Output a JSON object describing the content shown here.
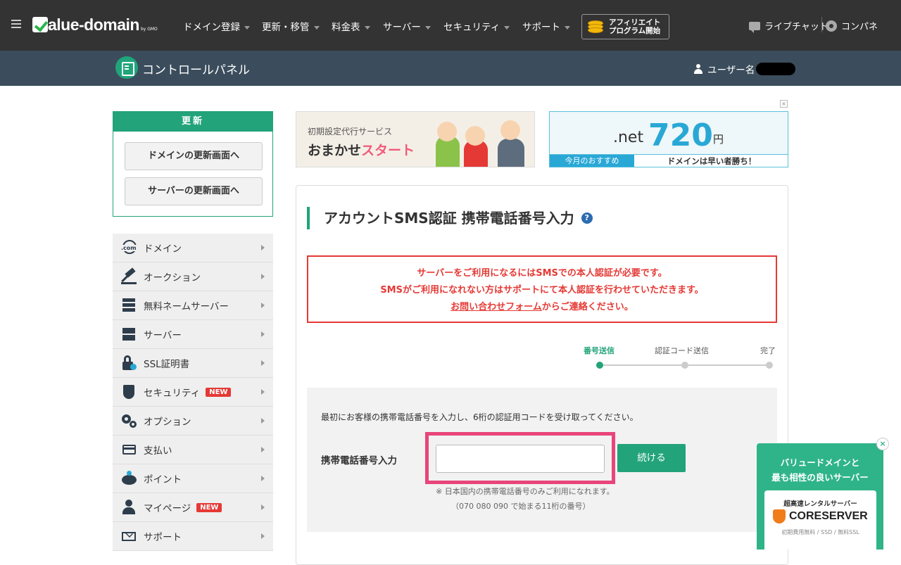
{
  "topnav": {
    "logo_text": "alue-domain",
    "logo_suffix": "by GMO",
    "items": [
      "ドメイン登録",
      "更新・移管",
      "料金表",
      "サーバー",
      "セキュリティ",
      "サポート"
    ],
    "affiliate_line1": "アフィリエイト",
    "affiliate_line2": "プログラム開始",
    "livechat": "ライブチャット",
    "cpanel": "コンパネ"
  },
  "subheader": {
    "title": "コントロールパネル",
    "user_label": "ユーザー名"
  },
  "renew": {
    "heading": "更新",
    "domain_button": "ドメインの更新画面へ",
    "server_button": "サーバーの更新画面へ"
  },
  "menu": [
    {
      "label": "ドメイン",
      "icon": "com-globe-icon",
      "badge": ""
    },
    {
      "label": "オークション",
      "icon": "gavel-icon",
      "badge": ""
    },
    {
      "label": "無料ネームサーバー",
      "icon": "server-stack-icon",
      "badge": ""
    },
    {
      "label": "サーバー",
      "icon": "server-icon",
      "badge": ""
    },
    {
      "label": "SSL証明書",
      "icon": "lock-icon",
      "badge": ""
    },
    {
      "label": "セキュリティ",
      "icon": "shield-icon",
      "badge": "NEW"
    },
    {
      "label": "オプション",
      "icon": "gears-icon",
      "badge": ""
    },
    {
      "label": "支払い",
      "icon": "card-icon",
      "badge": ""
    },
    {
      "label": "ポイント",
      "icon": "piggy-bank-icon",
      "badge": ""
    },
    {
      "label": "マイページ",
      "icon": "user-icon",
      "badge": "NEW"
    },
    {
      "label": "サポート",
      "icon": "mail-icon",
      "badge": ""
    }
  ],
  "banner1": {
    "sub": "初期設定代行サービス",
    "main_a": "おまかせ",
    "main_b": "スタート"
  },
  "banner2": {
    "tld": ".net",
    "price": "720",
    "yen": "円",
    "left": "今月のおすすめ",
    "right": "ドメインは早い者勝ち！",
    "close": "×"
  },
  "page": {
    "title": "アカウントSMS認証 携帯電話番号入力",
    "help": "?"
  },
  "alert": {
    "line1": "サーバーをご利用になるにはSMSでの本人認証が必要です。",
    "line2": "SMSがご利用になれない方はサポートにて本人認証を行わせていただきます。",
    "link": "お問い合わせフォーム",
    "line3_rest": "からご連絡ください。"
  },
  "steps": {
    "items": [
      "番号送信",
      "認証コード送信",
      "完了"
    ],
    "current": 0,
    "active_color": "#23a37a"
  },
  "form": {
    "intro": "最初にお客様の携帯電話番号を入力し、6桁の認証用コードを受け取ってください。",
    "label": "携帯電話番号入力",
    "value": "",
    "button": "続ける",
    "note1": "※ 日本国内の携帯電話番号のみご利用になれます。",
    "note2": "（070 080 090 で始まる11桁の番号）"
  },
  "promo": {
    "close": "×",
    "line1": "バリュードメインと",
    "line2": "最も相性の良いサーバー",
    "card_top": "超高速レンタルサーバー",
    "card_name": "CORESERVER",
    "card_bottom": "初期費用無料 / SSD / 無料SSL"
  },
  "colors": {
    "nav_bg": "#333333",
    "subheader_bg": "#3b4d5c",
    "accent_green": "#23a37a",
    "alert_red": "#e53935",
    "highlight_pink": "#e8457a"
  }
}
